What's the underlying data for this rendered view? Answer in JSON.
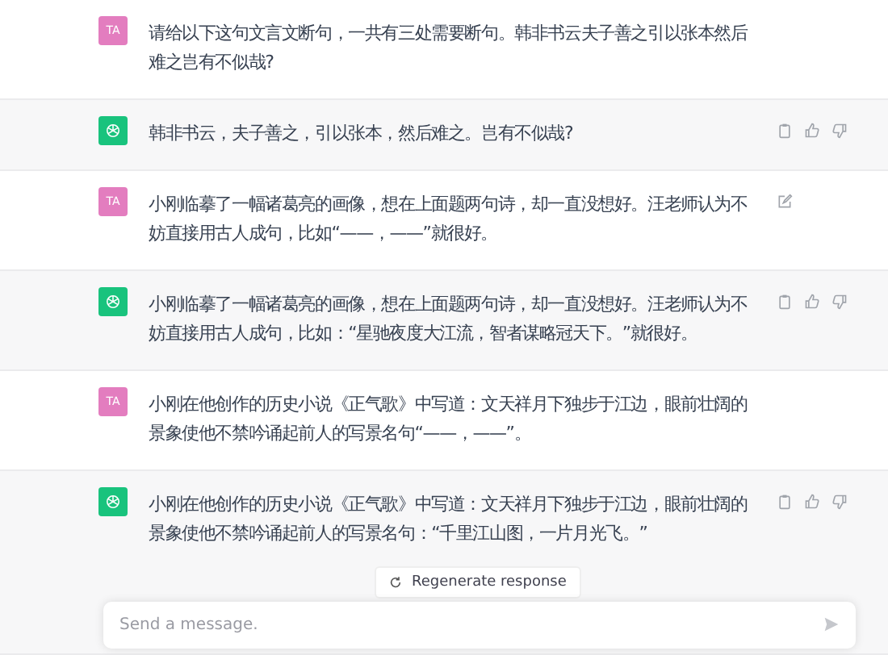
{
  "messages": [
    {
      "kind": "user",
      "avatar": "TA",
      "text": "请给以下这句文言文断句，一共有三处需要断句。韩非书云夫子善之引以张本然后难之岂有不似哉?",
      "editable": false
    },
    {
      "kind": "assistant",
      "text": "韩非书云，夫子善之，引以张本，然后难之。岂有不似哉?"
    },
    {
      "kind": "user",
      "avatar": "TA",
      "text": "小刚临摹了一幅诸葛亮的画像，想在上面题两句诗，却一直没想好。汪老师认为不妨直接用古人成句，比如“——，——”就很好。",
      "editable": true
    },
    {
      "kind": "assistant",
      "text": "小刚临摹了一幅诸葛亮的画像，想在上面题两句诗，却一直没想好。汪老师认为不妨直接用古人成句，比如：“星驰夜度大江流，智者谋略冠天下。”就很好。"
    },
    {
      "kind": "user",
      "avatar": "TA",
      "text": "小刚在他创作的历史小说《正气歌》中写道：文天祥月下独步于江边，眼前壮阔的景象使他不禁吟诵起前人的写景名句“——，——”。",
      "editable": false
    },
    {
      "kind": "assistant",
      "text": "小刚在他创作的历史小说《正气歌》中写道：文天祥月下独步于江边，眼前壮阔的景象使他不禁吟诵起前人的写景名句：“千里江山图，一片月光飞。”"
    }
  ],
  "regenerate_button": "Regenerate response",
  "composer": {
    "placeholder": "Send a message."
  }
}
